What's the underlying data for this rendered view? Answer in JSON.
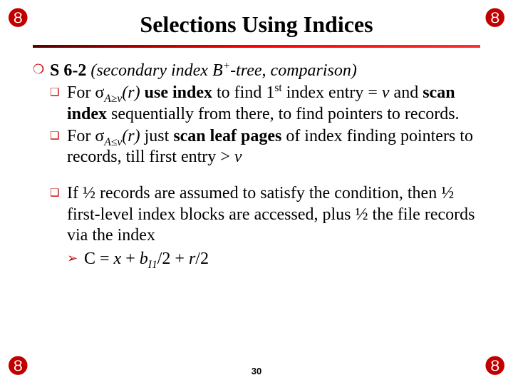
{
  "corner_glyph": "❽",
  "title": "Selections Using Indices",
  "s62_label": "S 6-2",
  "s62_desc_open": " (secondary index B",
  "s62_desc_sup": "+",
  "s62_desc_close": "-tree, comparison)",
  "b1_for": "For ",
  "sigma1": "σ",
  "sigma1_sub": "A≥v",
  "sigma1_r": "(r)",
  "b1_mid1": "  use index",
  "b1_mid2": " to find 1",
  "b1_sup_st": "st",
  "b1_mid3": " index entry = ",
  "b1_v": "v",
  "b1_and": " and ",
  "b1_scan": "scan index",
  "b1_tail": " sequentially from there, to find pointers to records.",
  "b2_for": "For ",
  "sigma2": "σ",
  "sigma2_sub": "A≤v",
  "sigma2_r": "(r)",
  "b2_mid": " just ",
  "b2_scan": "scan leaf pages",
  "b2_tail1": " of index finding pointers to records, till first entry ",
  "b2_gt": ">",
  "b2_v": " v",
  "b3_text": "If ½ records are assumed to satisfy the condition, then ½ first-level index blocks are accessed, plus ½ the file records via the index",
  "cost_c": "C = ",
  "cost_x": "x",
  "cost_plus1": " + ",
  "cost_b": "b",
  "cost_bsub": "I1",
  "cost_half1": "/2 + ",
  "cost_r": "r",
  "cost_half2": "/2",
  "page_num": "30"
}
